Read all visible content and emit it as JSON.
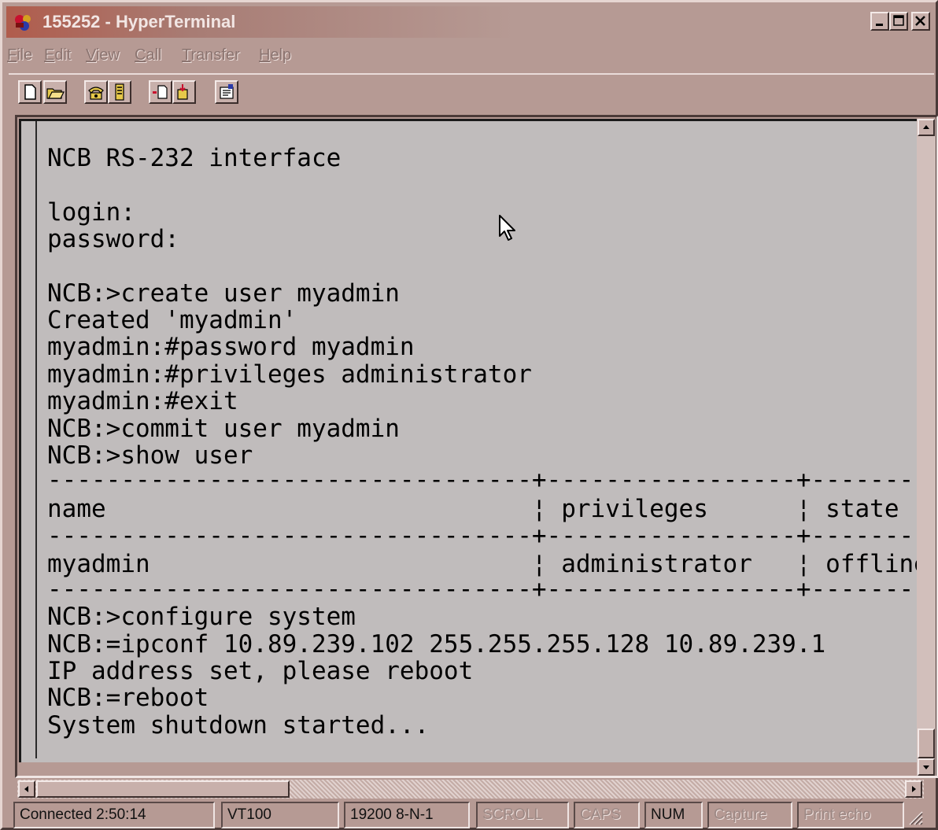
{
  "window": {
    "title": "155252 - HyperTerminal",
    "colors": {
      "frame": "#b69a94",
      "title_active": "#b05c4c",
      "terminal_bg": "#c0bcbc",
      "terminal_text": "#000000"
    }
  },
  "title_icons": {
    "app": "hyperterminal-icon",
    "minimize": "minimize-icon",
    "maximize": "maximize-icon",
    "close": "close-icon"
  },
  "menu": {
    "items": [
      {
        "label": "File",
        "key": "F",
        "rest": "ile"
      },
      {
        "label": "Edit",
        "key": "E",
        "rest": "dit"
      },
      {
        "label": "View",
        "key": "V",
        "rest": "iew"
      },
      {
        "label": "Call",
        "key": "C",
        "rest": "all"
      },
      {
        "label": "Transfer",
        "key": "T",
        "rest": "ransfer"
      },
      {
        "label": "Help",
        "key": "H",
        "rest": "elp"
      }
    ]
  },
  "toolbar": {
    "buttons": [
      {
        "icon": "new-document-icon"
      },
      {
        "icon": "open-folder-icon"
      },
      {
        "icon": "call-phone-icon"
      },
      {
        "icon": "disconnect-phone-icon"
      },
      {
        "icon": "send-file-icon"
      },
      {
        "icon": "receive-file-icon"
      },
      {
        "icon": "properties-icon"
      }
    ]
  },
  "terminal": {
    "lines": [
      "NCB RS-232 interface",
      "",
      "login:",
      "password:",
      "",
      "NCB:>create user myadmin",
      "Created 'myadmin'",
      "myadmin:#password myadmin",
      "myadmin:#privileges administrator",
      "myadmin:#exit",
      "NCB:>commit user myadmin",
      "NCB:>show user",
      "---------------------------------+-----------------+-------",
      "name                             ¦ privileges      ¦ state",
      "---------------------------------+-----------------+-------",
      "myadmin                          ¦ administrator   ¦ offline",
      "---------------------------------+-----------------+-------",
      "NCB:>configure system",
      "NCB:=ipconf 10.89.239.102 255.255.255.128 10.89.239.1",
      "IP address set, please reboot",
      "NCB:=reboot",
      "System shutdown started..."
    ],
    "cursor_icon": "mouse-pointer-icon"
  },
  "statusbar": {
    "connected": "Connected 2:50:14",
    "emulation": "VT100",
    "port_settings": "19200 8-N-1",
    "scroll": "SCROLL",
    "caps": "CAPS",
    "num": "NUM",
    "capture": "Capture",
    "print_echo": "Print echo"
  }
}
